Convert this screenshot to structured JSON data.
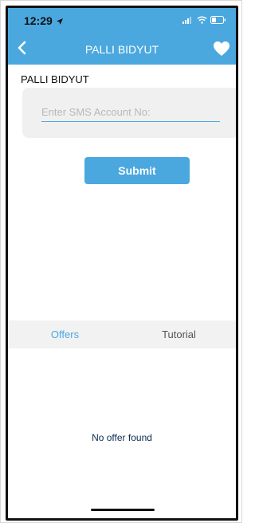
{
  "status_bar": {
    "time": "12:29",
    "location_icon": "location-arrow-icon",
    "signal_icon": "signal-bars-icon",
    "wifi_icon": "wifi-icon",
    "battery_icon": "battery-icon"
  },
  "header": {
    "title": "PALLI BIDYUT",
    "back_icon": "chevron-left-icon",
    "favorite_icon": "heart-icon",
    "accent_color": "#4aa8df"
  },
  "form": {
    "section_title": "PALLI BIDYUT",
    "sms_account": {
      "placeholder": "Enter SMS Account No:",
      "value": ""
    },
    "submit_label": "Submit"
  },
  "tabs": [
    {
      "label": "Offers",
      "active": true
    },
    {
      "label": "Tutorial",
      "active": false
    }
  ],
  "empty_state": {
    "message": "No offer found"
  }
}
